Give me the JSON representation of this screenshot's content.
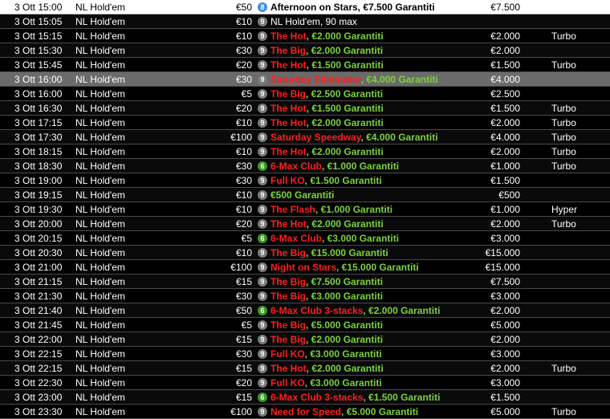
{
  "tournaments": [
    {
      "date": "3 Ott",
      "time": "15:00",
      "game": "NL Hold'em",
      "buyin": "€50",
      "badge": "8",
      "badge_color": "blue",
      "name_parts": [
        {
          "text": "Afternoon on Stars, €7.500 Garantiti",
          "color": "white"
        }
      ],
      "guarantee": "€7.500",
      "speed": ""
    },
    {
      "date": "3 Ott",
      "time": "15:05",
      "game": "NL Hold'em",
      "buyin": "€10",
      "badge": "9",
      "badge_color": "grey",
      "name_parts": [
        {
          "text": "NL Hold'em, 90 max",
          "color": "white"
        }
      ],
      "guarantee": "",
      "speed": ""
    },
    {
      "date": "3 Ott",
      "time": "15:15",
      "game": "NL Hold'em",
      "buyin": "€10",
      "badge": "9",
      "badge_color": "grey",
      "name_parts": [
        {
          "text": "The Hot",
          "color": "red"
        },
        {
          "text": ", €2.000 Garantiti",
          "color": "green"
        }
      ],
      "guarantee": "€2.000",
      "speed": "Turbo"
    },
    {
      "date": "3 Ott",
      "time": "15:30",
      "game": "NL Hold'em",
      "buyin": "€30",
      "badge": "9",
      "badge_color": "grey",
      "name_parts": [
        {
          "text": "The Big",
          "color": "red"
        },
        {
          "text": ", €2.000 Garantiti",
          "color": "green"
        }
      ],
      "guarantee": "€2.000",
      "speed": ""
    },
    {
      "date": "3 Ott",
      "time": "15:45",
      "game": "NL Hold'em",
      "buyin": "€20",
      "badge": "9",
      "badge_color": "grey",
      "name_parts": [
        {
          "text": "The Hot",
          "color": "red"
        },
        {
          "text": ", €1.500 Garantiti",
          "color": "green"
        }
      ],
      "guarantee": "€1.500",
      "speed": "Turbo"
    },
    {
      "date": "3 Ott",
      "time": "16:00",
      "game": "NL Hold'em",
      "buyin": "€30",
      "badge": "9",
      "badge_color": "grey",
      "name_parts": [
        {
          "text": "Saturday Eliminator",
          "color": "red"
        },
        {
          "text": ", €4.000 Garantiti",
          "color": "green"
        }
      ],
      "guarantee": "€4.000",
      "speed": ""
    },
    {
      "date": "3 Ott",
      "time": "16:00",
      "game": "NL Hold'em",
      "buyin": "€5",
      "badge": "9",
      "badge_color": "grey",
      "name_parts": [
        {
          "text": "The Big",
          "color": "red"
        },
        {
          "text": ", €2.500 Garantiti",
          "color": "green"
        }
      ],
      "guarantee": "€2.500",
      "speed": ""
    },
    {
      "date": "3 Ott",
      "time": "16:30",
      "game": "NL Hold'em",
      "buyin": "€20",
      "badge": "9",
      "badge_color": "grey",
      "name_parts": [
        {
          "text": "The Hot",
          "color": "red"
        },
        {
          "text": ", €1.500 Garantiti",
          "color": "green"
        }
      ],
      "guarantee": "€1.500",
      "speed": "Turbo"
    },
    {
      "date": "3 Ott",
      "time": "17:15",
      "game": "NL Hold'em",
      "buyin": "€10",
      "badge": "9",
      "badge_color": "grey",
      "name_parts": [
        {
          "text": "The Hot",
          "color": "red"
        },
        {
          "text": ", €2.000 Garantiti",
          "color": "green"
        }
      ],
      "guarantee": "€2.000",
      "speed": "Turbo"
    },
    {
      "date": "3 Ott",
      "time": "17:30",
      "game": "NL Hold'em",
      "buyin": "€100",
      "badge": "9",
      "badge_color": "grey",
      "name_parts": [
        {
          "text": "Saturday Speedway",
          "color": "red"
        },
        {
          "text": ", €4.000 Garantiti",
          "color": "green"
        }
      ],
      "guarantee": "€4.000",
      "speed": "Turbo"
    },
    {
      "date": "3 Ott",
      "time": "18:15",
      "game": "NL Hold'em",
      "buyin": "€10",
      "badge": "9",
      "badge_color": "grey",
      "name_parts": [
        {
          "text": "The Hot",
          "color": "red"
        },
        {
          "text": ", €2.000 Garantiti",
          "color": "green"
        }
      ],
      "guarantee": "€2.000",
      "speed": "Turbo"
    },
    {
      "date": "3 Ott",
      "time": "18:30",
      "game": "NL Hold'em",
      "buyin": "€30",
      "badge": "6",
      "badge_color": "green",
      "name_parts": [
        {
          "text": "6-Max Club",
          "color": "red"
        },
        {
          "text": ", €1.000 Garantiti",
          "color": "green"
        }
      ],
      "guarantee": "€1.000",
      "speed": "Turbo"
    },
    {
      "date": "3 Ott",
      "time": "19:00",
      "game": "NL Hold'em",
      "buyin": "€30",
      "badge": "9",
      "badge_color": "grey",
      "name_parts": [
        {
          "text": "Full KO",
          "color": "red"
        },
        {
          "text": ", €1.500 Garantiti",
          "color": "green"
        }
      ],
      "guarantee": "€1.500",
      "speed": ""
    },
    {
      "date": "3 Ott",
      "time": "19:15",
      "game": "NL Hold'em",
      "buyin": "€10",
      "badge": "9",
      "badge_color": "grey",
      "name_parts": [
        {
          "text": "€500 Garantiti",
          "color": "green"
        }
      ],
      "guarantee": "€500",
      "speed": ""
    },
    {
      "date": "3 Ott",
      "time": "19:30",
      "game": "NL Hold'em",
      "buyin": "€10",
      "badge": "9",
      "badge_color": "grey",
      "name_parts": [
        {
          "text": "The Flash",
          "color": "red"
        },
        {
          "text": ", €1.000 Garantiti",
          "color": "green"
        }
      ],
      "guarantee": "€1.000",
      "speed": "Hyper"
    },
    {
      "date": "3 Ott",
      "time": "20:00",
      "game": "NL Hold'em",
      "buyin": "€20",
      "badge": "9",
      "badge_color": "grey",
      "name_parts": [
        {
          "text": "The Hot",
          "color": "red"
        },
        {
          "text": ", €2.000 Garantiti",
          "color": "green"
        }
      ],
      "guarantee": "€2.000",
      "speed": "Turbo"
    },
    {
      "date": "3 Ott",
      "time": "20:15",
      "game": "NL Hold'em",
      "buyin": "€5",
      "badge": "6",
      "badge_color": "green",
      "name_parts": [
        {
          "text": "6-Max Club",
          "color": "red"
        },
        {
          "text": ", €3.000 Garantiti",
          "color": "green"
        }
      ],
      "guarantee": "€3.000",
      "speed": ""
    },
    {
      "date": "3 Ott",
      "time": "20:30",
      "game": "NL Hold'em",
      "buyin": "€10",
      "badge": "9",
      "badge_color": "grey",
      "name_parts": [
        {
          "text": "The Big",
          "color": "red"
        },
        {
          "text": ", €15.000 Garantiti",
          "color": "green"
        }
      ],
      "guarantee": "€15.000",
      "speed": ""
    },
    {
      "date": "3 Ott",
      "time": "21:00",
      "game": "NL Hold'em",
      "buyin": "€100",
      "badge": "9",
      "badge_color": "grey",
      "name_parts": [
        {
          "text": "Night on Stars",
          "color": "red"
        },
        {
          "text": ", €15.000 Garantiti",
          "color": "green"
        }
      ],
      "guarantee": "€15.000",
      "speed": ""
    },
    {
      "date": "3 Ott",
      "time": "21:15",
      "game": "NL Hold'em",
      "buyin": "€15",
      "badge": "9",
      "badge_color": "grey",
      "name_parts": [
        {
          "text": "The Big",
          "color": "red"
        },
        {
          "text": ", €7.500 Garantiti",
          "color": "green"
        }
      ],
      "guarantee": "€7.500",
      "speed": ""
    },
    {
      "date": "3 Ott",
      "time": "21:30",
      "game": "NL Hold'em",
      "buyin": "€30",
      "badge": "9",
      "badge_color": "grey",
      "name_parts": [
        {
          "text": "The Big",
          "color": "red"
        },
        {
          "text": ", €3.000 Garantiti",
          "color": "green"
        }
      ],
      "guarantee": "€3.000",
      "speed": ""
    },
    {
      "date": "3 Ott",
      "time": "21:40",
      "game": "NL Hold'em",
      "buyin": "€50",
      "badge": "6",
      "badge_color": "green",
      "name_parts": [
        {
          "text": "6-Max Club 3-stacks",
          "color": "red"
        },
        {
          "text": ", €2.000 Garantiti",
          "color": "green"
        }
      ],
      "guarantee": "€2.000",
      "speed": ""
    },
    {
      "date": "3 Ott",
      "time": "21:45",
      "game": "NL Hold'em",
      "buyin": "€5",
      "badge": "9",
      "badge_color": "grey",
      "name_parts": [
        {
          "text": "The Big",
          "color": "red"
        },
        {
          "text": ", €5.000 Garantiti",
          "color": "green"
        }
      ],
      "guarantee": "€5.000",
      "speed": ""
    },
    {
      "date": "3 Ott",
      "time": "22:00",
      "game": "NL Hold'em",
      "buyin": "€15",
      "badge": "9",
      "badge_color": "grey",
      "name_parts": [
        {
          "text": "The Big",
          "color": "red"
        },
        {
          "text": ", €2.000 Garantiti",
          "color": "green"
        }
      ],
      "guarantee": "€2.000",
      "speed": ""
    },
    {
      "date": "3 Ott",
      "time": "22:15",
      "game": "NL Hold'em",
      "buyin": "€30",
      "badge": "9",
      "badge_color": "grey",
      "name_parts": [
        {
          "text": "Full KO",
          "color": "red"
        },
        {
          "text": ", €3.000 Garantiti",
          "color": "green"
        }
      ],
      "guarantee": "€3.000",
      "speed": ""
    },
    {
      "date": "3 Ott",
      "time": "22:15",
      "game": "NL Hold'em",
      "buyin": "€15",
      "badge": "9",
      "badge_color": "grey",
      "name_parts": [
        {
          "text": "The Hot",
          "color": "red"
        },
        {
          "text": ", €2.000 Garantiti",
          "color": "green"
        }
      ],
      "guarantee": "€2.000",
      "speed": "Turbo"
    },
    {
      "date": "3 Ott",
      "time": "22:30",
      "game": "NL Hold'em",
      "buyin": "€20",
      "badge": "9",
      "badge_color": "grey",
      "name_parts": [
        {
          "text": "Full KO",
          "color": "red"
        },
        {
          "text": ", €3.000 Garantiti",
          "color": "green"
        }
      ],
      "guarantee": "€3.000",
      "speed": ""
    },
    {
      "date": "3 Ott",
      "time": "23:00",
      "game": "NL Hold'em",
      "buyin": "€15",
      "badge": "6",
      "badge_color": "green",
      "name_parts": [
        {
          "text": "6-Max Club 3-stacks",
          "color": "red"
        },
        {
          "text": ", €1.500 Garantiti",
          "color": "green"
        }
      ],
      "guarantee": "€1.500",
      "speed": ""
    },
    {
      "date": "3 Ott",
      "time": "23:30",
      "game": "NL Hold'em",
      "buyin": "€100",
      "badge": "9",
      "badge_color": "grey",
      "name_parts": [
        {
          "text": "Need for Speed",
          "color": "red"
        },
        {
          "text": ", €5.000 Garantiti",
          "color": "green"
        }
      ],
      "guarantee": "€5.000",
      "speed": "Turbo"
    }
  ],
  "selected_index": 5,
  "colors": {
    "name_red": "#ff1e1e",
    "guarantee_green": "#7cd13b",
    "badge_grey": "#7a7a7a",
    "badge_green": "#3a9a22",
    "badge_blue": "#3f8fe0",
    "selected_row": "#6b6b6b"
  }
}
